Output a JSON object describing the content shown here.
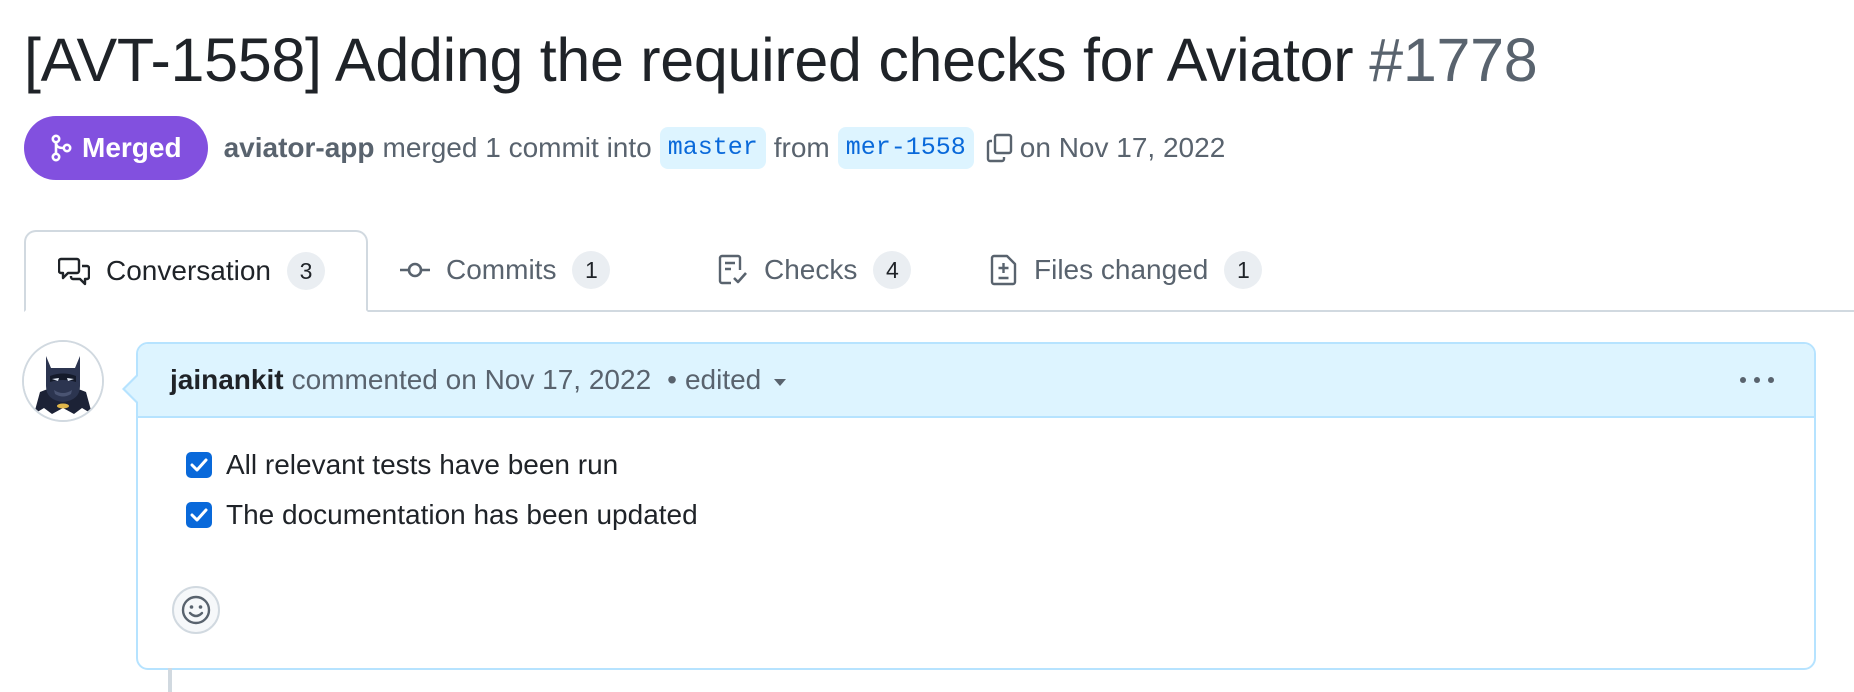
{
  "pull_request": {
    "title": "[AVT-1558] Adding the required checks for Aviator",
    "number": "#1778",
    "state": "Merged",
    "author": "aviator-app",
    "action_text": "merged 1 commit into",
    "base_branch": "master",
    "from_text": "from",
    "head_branch": "mer-1558",
    "merged_date": "on Nov 17, 2022"
  },
  "tabs": [
    {
      "label": "Conversation",
      "count": "3",
      "icon": "conversation-icon",
      "active": true
    },
    {
      "label": "Commits",
      "count": "1",
      "icon": "commit-icon",
      "active": false
    },
    {
      "label": "Checks",
      "count": "4",
      "icon": "checklist-icon",
      "active": false
    },
    {
      "label": "Files changed",
      "count": "1",
      "icon": "file-diff-icon",
      "active": false
    }
  ],
  "comment": {
    "author": "jainankit",
    "meta": "commented on Nov 17, 2022",
    "separator": "•",
    "edited": "edited",
    "tasks": [
      {
        "label": "All relevant tests have been run",
        "checked": true
      },
      {
        "label": "The documentation has been updated",
        "checked": true
      }
    ]
  },
  "colors": {
    "merged_badge": "#8250df",
    "branch_bg": "#ddf4ff",
    "branch_text": "#0969da",
    "comment_header_bg": "#ddf4ff",
    "comment_border": "#b6e3ff",
    "checkbox": "#0969da"
  },
  "icons": {
    "merged": "git-merge-icon",
    "copy": "copy-icon",
    "more": "kebab-horizontal-icon",
    "caret": "triangle-down-icon",
    "reaction": "smiley-icon",
    "avatar": "avatar"
  }
}
